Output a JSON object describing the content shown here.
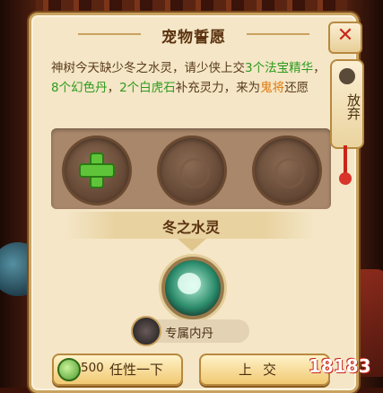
{
  "panel": {
    "title": "宠物誓愿",
    "description_parts": [
      {
        "text": "神树今天缺少冬之水灵，请少侠上交",
        "style": "normal"
      },
      {
        "text": "3个法宝精华",
        "style": "green"
      },
      {
        "text": "，",
        "style": "normal"
      },
      {
        "text": "8个幻色丹",
        "style": "green"
      },
      {
        "text": "，",
        "style": "normal"
      },
      {
        "text": "2个白虎石",
        "style": "green"
      },
      {
        "text": "补充灵力，来为",
        "style": "normal"
      },
      {
        "text": "鬼将",
        "style": "orange"
      },
      {
        "text": "还愿",
        "style": "normal"
      }
    ],
    "target_name": "冬之水灵",
    "exclusive_label": "专属内丹"
  },
  "buttons": {
    "left_cost": "500",
    "left_label": "任性一下",
    "right_label": "上交"
  },
  "side": {
    "close_symbol": "✕",
    "giveup_label": "放弃"
  },
  "watermark": "18183",
  "colors": {
    "green_highlight": "#2e9a1e",
    "orange_highlight": "#e07a10",
    "close_red": "#c8261a"
  }
}
